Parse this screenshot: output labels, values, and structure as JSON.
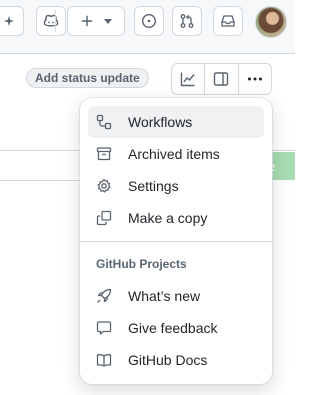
{
  "header": {
    "icons": [
      "sparkle-icon",
      "copilot-icon",
      "plus-icon",
      "triangle-down-icon",
      "issue-circle-icon",
      "pull-request-icon",
      "inbox-icon"
    ]
  },
  "toolbar": {
    "status_label": "Add status update",
    "view_icons": [
      "graph-icon",
      "sidebar-panel-icon",
      "kebab-horizontal-icon"
    ]
  },
  "menu": {
    "items": [
      {
        "label": "Workflows",
        "icon": "workflow-icon",
        "active": true
      },
      {
        "label": "Archived items",
        "icon": "archive-icon"
      },
      {
        "label": "Settings",
        "icon": "gear-icon"
      },
      {
        "label": "Make a copy",
        "icon": "copy-icon"
      }
    ],
    "group_header": "GitHub Projects",
    "group_items": [
      {
        "label": "What’s new",
        "icon": "rocket-icon"
      },
      {
        "label": "Give feedback",
        "icon": "comment-icon"
      },
      {
        "label": "GitHub Docs",
        "icon": "book-icon"
      }
    ]
  },
  "partial_button_label": "e"
}
